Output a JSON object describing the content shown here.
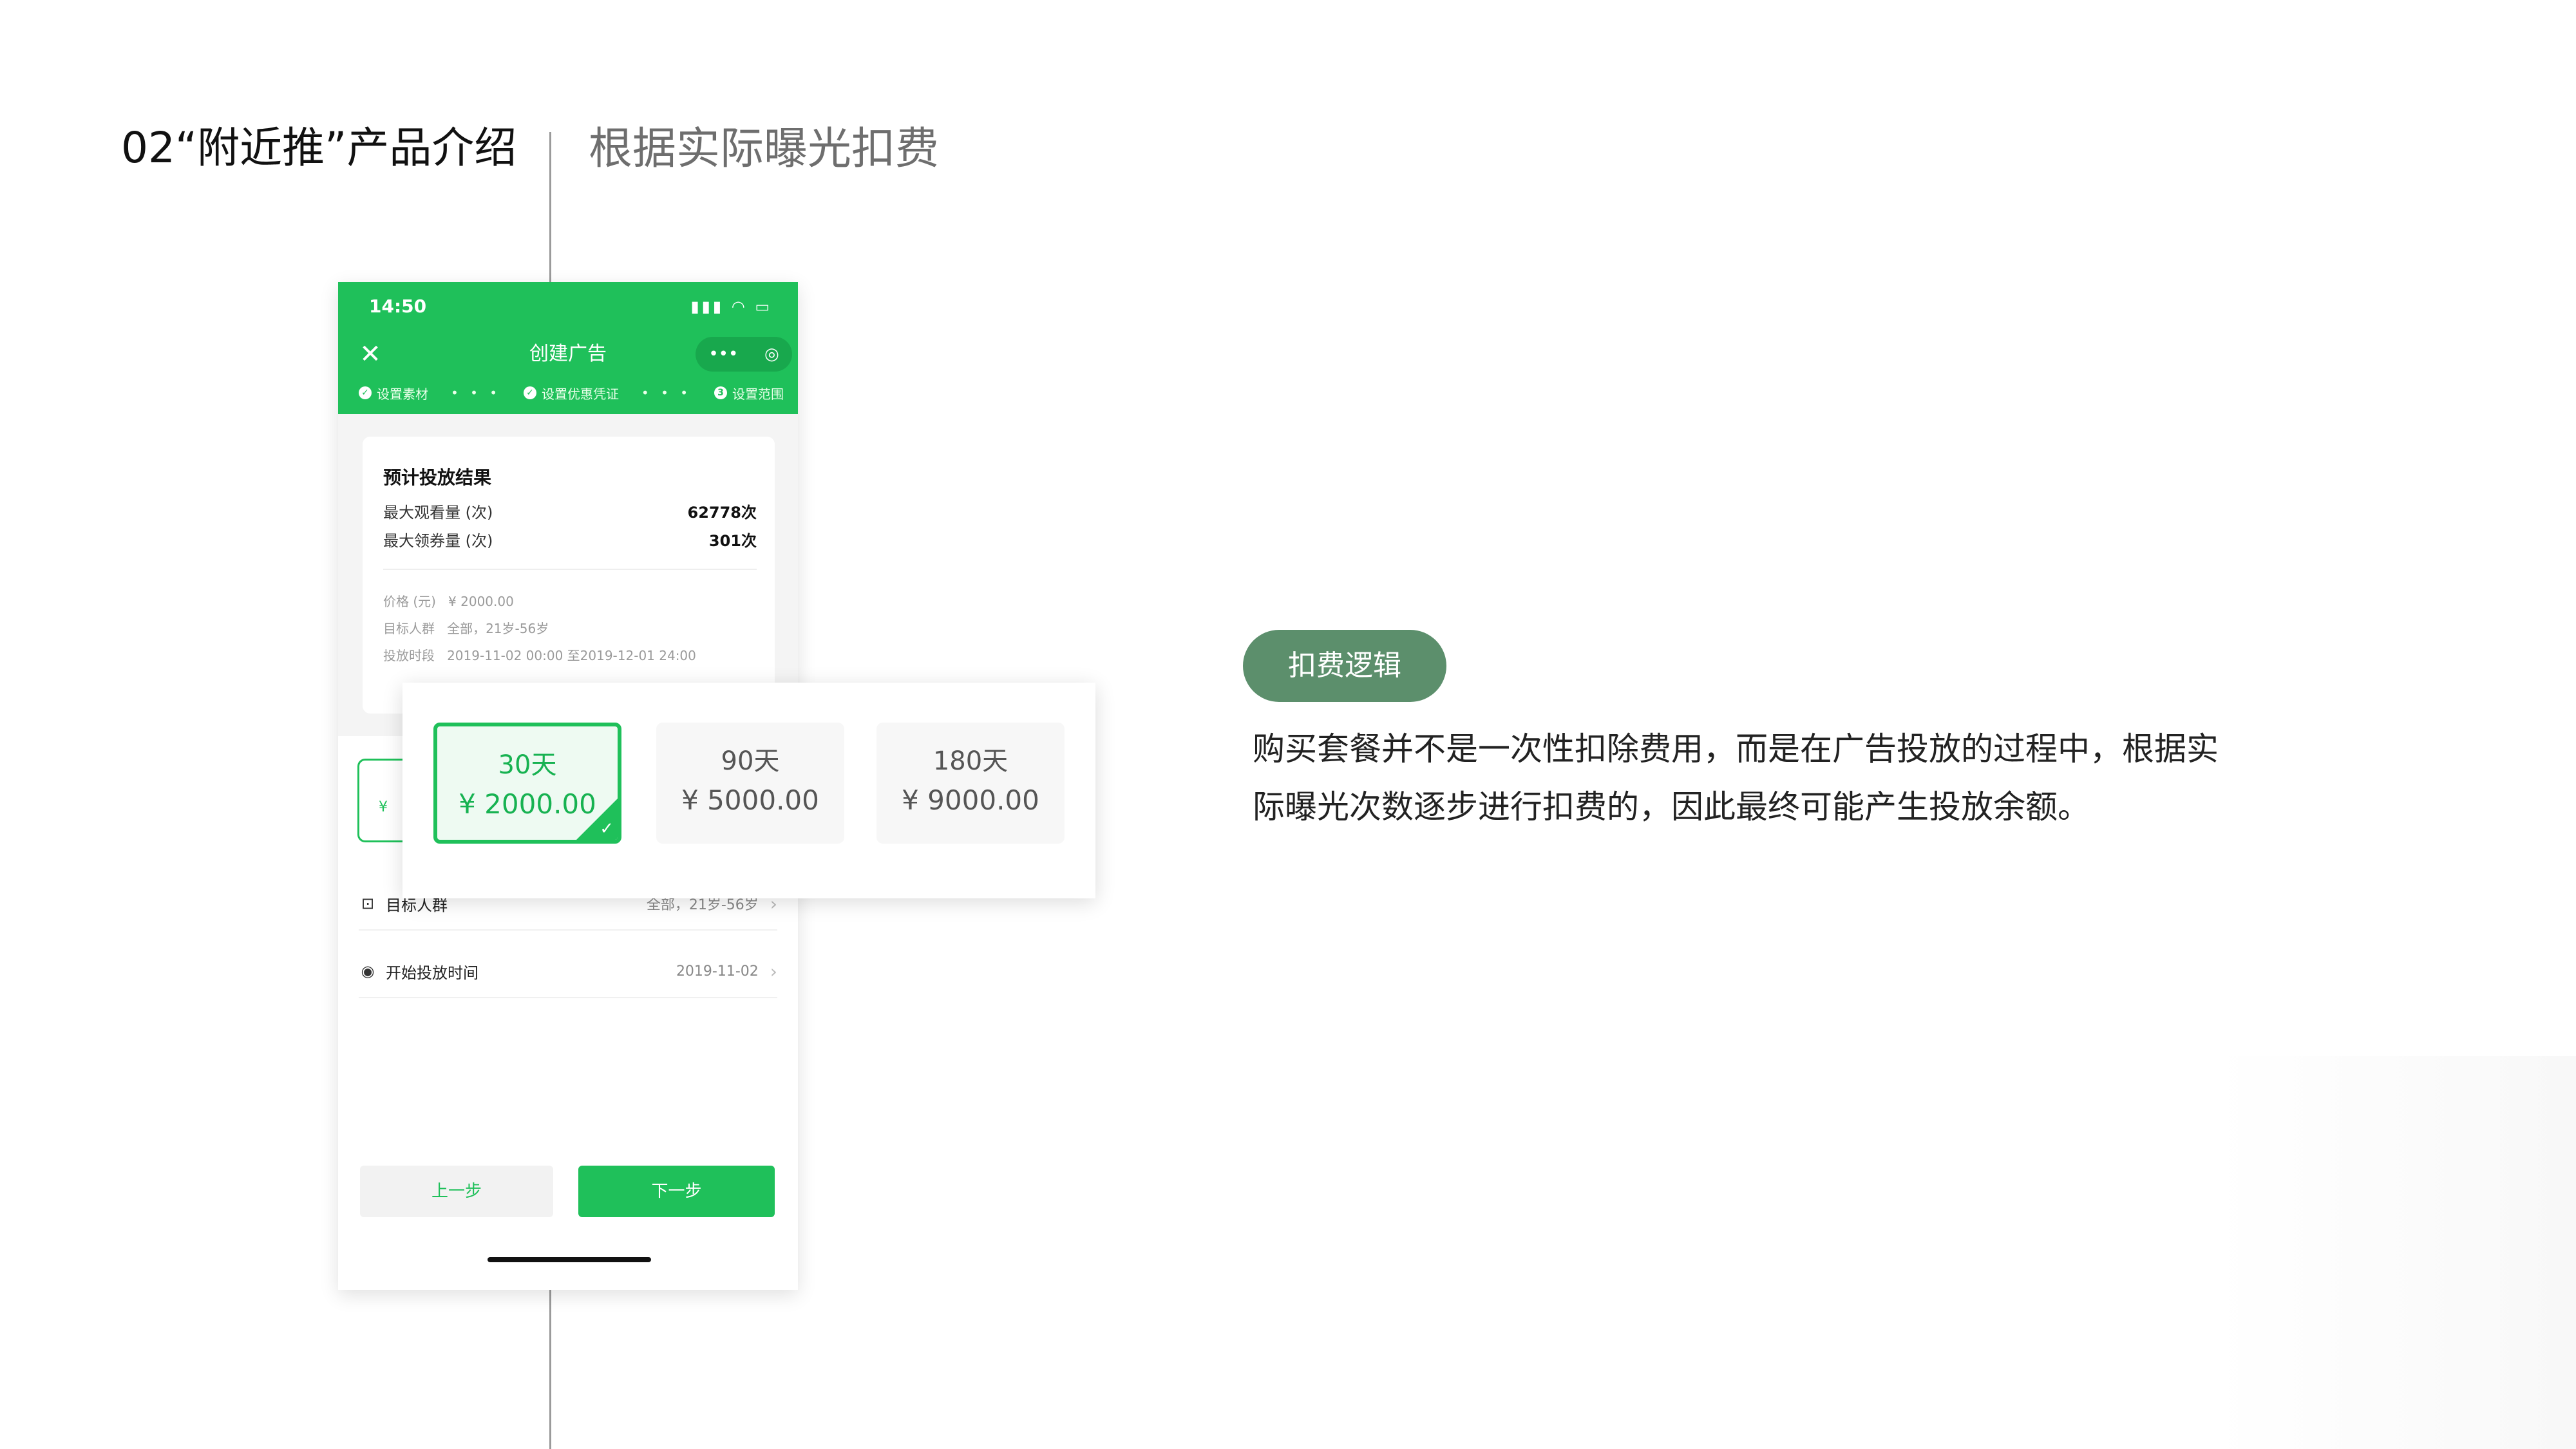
{
  "slide": {
    "title": "02“附近推”产品介绍",
    "subtitle": "根据实际曝光扣费"
  },
  "phone": {
    "status_time": "14:50",
    "nav_title": "创建广告",
    "capsule_more": "•••",
    "capsule_target": "◎",
    "steps": [
      "设置素材",
      "设置优惠凭证",
      "设置范围"
    ],
    "step_separator": "• • •",
    "result": {
      "title": "预计投放结果",
      "rows": [
        {
          "label": "最大观看量 (次)",
          "value": "62778次"
        },
        {
          "label": "最大领券量 (次)",
          "value": "301次"
        }
      ],
      "details": [
        {
          "label": "价格 (元)",
          "value": "¥ 2000.00"
        },
        {
          "label": "目标人群",
          "value": "全部，21岁-56岁"
        },
        {
          "label": "投放时段",
          "value": "2019-11-02 00:00 至2019-12-01 24:00"
        }
      ]
    },
    "background_package_price": "¥",
    "settings": [
      {
        "label": "目标人群",
        "value": "全部，21岁-56岁"
      },
      {
        "label": "开始投放时间",
        "value": "2019-11-02"
      }
    ],
    "prev_button": "上一步",
    "next_button": "下一步"
  },
  "packages": [
    {
      "days": "30天",
      "price": "¥ 2000.00",
      "selected": true
    },
    {
      "days": "90天",
      "price": "¥ 5000.00",
      "selected": false
    },
    {
      "days": "180天",
      "price": "¥ 9000.00",
      "selected": false
    }
  ],
  "explanation": {
    "tag": "扣费逻辑",
    "text": "购买套餐并不是一次性扣除费用，而是在广告投放的过程中，根据实际曝光次数逐步进行扣费的，因此最终可能产生投放余额。"
  },
  "colors": {
    "brand_green": "#1fc05a",
    "tag_green": "#5c8f6c"
  }
}
